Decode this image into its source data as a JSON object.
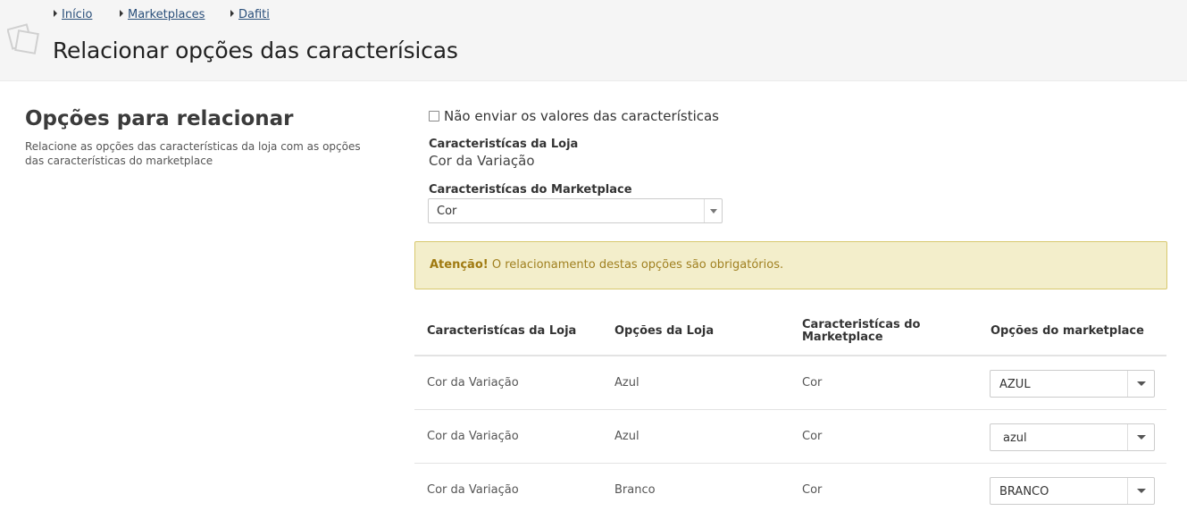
{
  "breadcrumb": {
    "items": [
      {
        "label": "Início"
      },
      {
        "label": "Marketplaces"
      },
      {
        "label": "Dafiti"
      }
    ]
  },
  "header": {
    "logo_icon": "stacked-cards-icon",
    "title": "Relacionar opções das caracterísicas"
  },
  "sidebar": {
    "title": "Opções para relacionar",
    "description": "Relacione as opções das características da loja com as opções das características do marketplace"
  },
  "form": {
    "checkbox_label": "Não enviar os valores das características",
    "checkbox_checked": false,
    "store_feature_label": "Caracteristícas da Loja",
    "store_feature_value": "Cor da Variação",
    "marketplace_feature_label": "Caracteristícas do Marketplace",
    "marketplace_feature_selected": "Cor"
  },
  "alert": {
    "strong": "Atenção!",
    "message": "O relacionamento destas opções são obrigatórios.",
    "color": "#f3eecb"
  },
  "table": {
    "headers": [
      "Caracteristícas da Loja",
      "Opções da Loja",
      "Caracteristícas do Marketplace",
      "Opções do marketplace"
    ],
    "rows": [
      {
        "store_feature": "Cor da Variação",
        "store_option": "Azul",
        "marketplace_feature": "Cor",
        "marketplace_option": "AZUL"
      },
      {
        "store_feature": "Cor da Variação",
        "store_option": "Azul",
        "marketplace_feature": "Cor",
        "marketplace_option": "azul"
      },
      {
        "store_feature": "Cor da Variação",
        "store_option": "Branco",
        "marketplace_feature": "Cor",
        "marketplace_option": "BRANCO"
      }
    ]
  }
}
